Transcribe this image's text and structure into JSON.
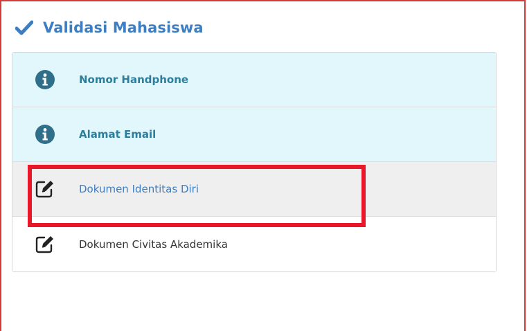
{
  "header": {
    "title": "Validasi Mahasiswa",
    "icon": "check-icon",
    "accent": "#3d7ec2"
  },
  "steps": [
    {
      "label": "Nomor Handphone",
      "icon": "info-icon",
      "state": "info"
    },
    {
      "label": "Alamat Email",
      "icon": "info-icon",
      "state": "info"
    },
    {
      "label": "Dokumen Identitas Diri",
      "icon": "edit-icon",
      "state": "active"
    },
    {
      "label": "Dokumen Civitas Akademika",
      "icon": "edit-icon",
      "state": "plain"
    }
  ],
  "colors": {
    "info_bg": "#e2f7fc",
    "active_bg": "#efefef",
    "highlight": "#e8182a"
  }
}
